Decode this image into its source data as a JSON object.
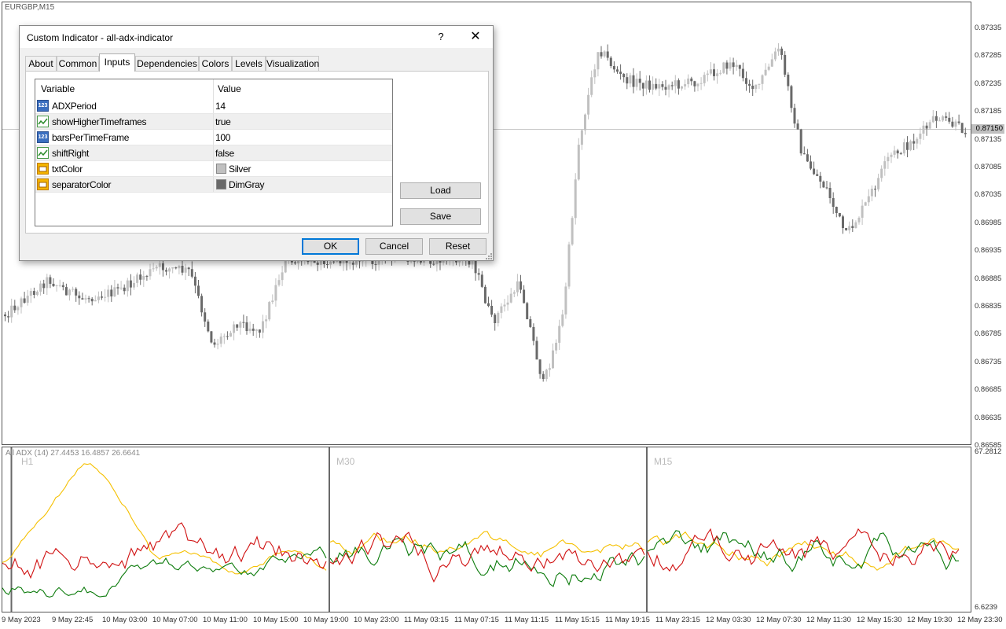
{
  "chart": {
    "symbol": "EURGBP,M15",
    "current_price": "0.87150",
    "price_axis": [
      "0.87335",
      "0.87285",
      "0.87235",
      "0.87185",
      "0.87135",
      "0.87085",
      "0.87035",
      "0.86985",
      "0.86935",
      "0.86885",
      "0.86835",
      "0.86785",
      "0.86735",
      "0.86685",
      "0.86635",
      "0.86585"
    ],
    "time_axis": [
      "9 May 2023",
      "9 May 22:45",
      "10 May 03:00",
      "10 May 07:00",
      "10 May 11:00",
      "10 May 15:00",
      "10 May 19:00",
      "10 May 23:00",
      "11 May 03:15",
      "11 May 07:15",
      "11 May 11:15",
      "11 May 15:15",
      "11 May 19:15",
      "11 May 23:15",
      "12 May 03:30",
      "12 May 07:30",
      "12 May 11:30",
      "12 May 15:30",
      "12 May 19:30",
      "12 May 23:30"
    ],
    "indicator_label": "All ADX (14) 27.4453 16.4857 26.6641",
    "indicator_axis_top": "67.2812",
    "indicator_axis_bottom": "6.6239",
    "timeframes": [
      "H1",
      "M30",
      "M15"
    ],
    "colors": {
      "adx": "#f5c000",
      "plus_di": "#0a7a0a",
      "minus_di": "#d01010",
      "bull_candle": "#c0c0c0",
      "bear_candle": "#696969"
    }
  },
  "dialog": {
    "title": "Custom Indicator - all-adx-indicator",
    "help": "?",
    "close": "✕",
    "tabs": [
      "About",
      "Common",
      "Inputs",
      "Dependencies",
      "Colors",
      "Levels",
      "Visualization"
    ],
    "active_tab": "Inputs",
    "columns": {
      "variable": "Variable",
      "value": "Value"
    },
    "inputs": [
      {
        "icon": "number-icon",
        "icon_text": "123",
        "name": "ADXPeriod",
        "value": "14"
      },
      {
        "icon": "boolean-icon",
        "name": "showHigherTimeframes",
        "value": "true"
      },
      {
        "icon": "number-icon",
        "icon_text": "123",
        "name": "barsPerTimeFrame",
        "value": "100"
      },
      {
        "icon": "boolean-icon",
        "name": "shiftRight",
        "value": "false"
      },
      {
        "icon": "color-icon",
        "name": "txtColor",
        "value": "Silver",
        "swatch": "#c0c0c0"
      },
      {
        "icon": "color-icon",
        "name": "separatorColor",
        "value": "DimGray",
        "swatch": "#696969"
      }
    ],
    "buttons": {
      "load": "Load",
      "save": "Save",
      "ok": "OK",
      "cancel": "Cancel",
      "reset": "Reset"
    }
  }
}
